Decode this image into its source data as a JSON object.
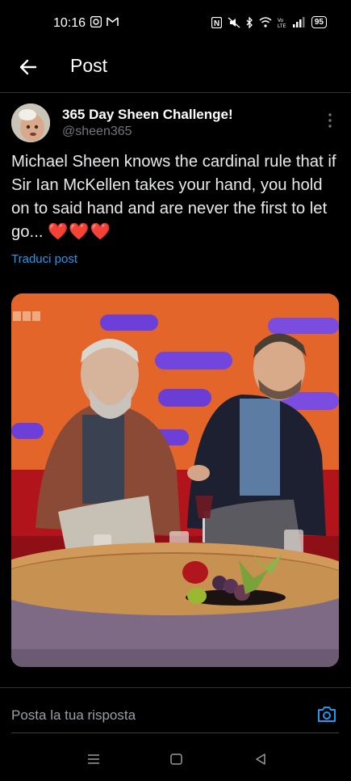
{
  "status_bar": {
    "time": "10:16",
    "battery": "95"
  },
  "header": {
    "title": "Post"
  },
  "post": {
    "author_name": "365 Day Sheen Challenge!",
    "author_handle": "@sheen365",
    "text": "Michael Sheen knows the cardinal rule that if Sir Ian McKellen takes your hand, you hold on to said hand and are never the first to let go...",
    "emoji": "❤️❤️❤️",
    "translate_label": "Traduci post",
    "media_watermark": "BBC"
  },
  "reply": {
    "placeholder": "Posta la tua risposta"
  },
  "colors": {
    "background": "#000000",
    "link": "#1d9bf0",
    "text": "#e7e9ea",
    "secondary": "#71767b"
  }
}
